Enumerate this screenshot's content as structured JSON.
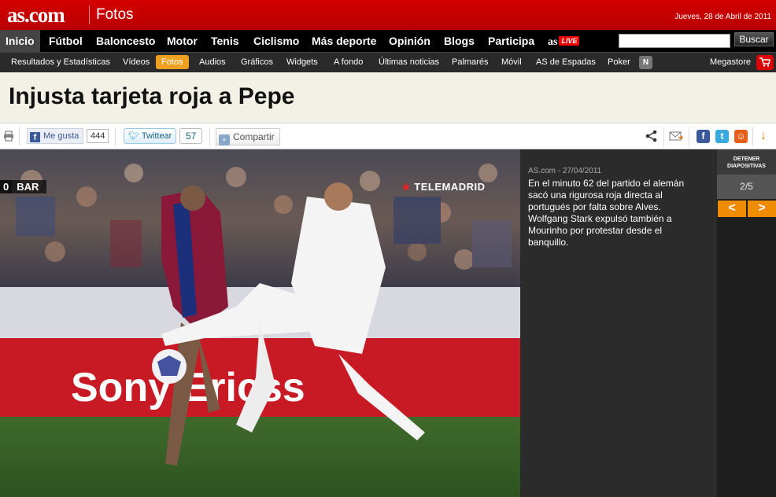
{
  "header": {
    "logo": "as.com",
    "section": "Fotos",
    "date": "Jueves, 28 de Abril de 2011"
  },
  "main_nav": {
    "items": [
      "Inicio",
      "Fútbol",
      "Baloncesto",
      "Motor",
      "Tenis",
      "Ciclismo",
      "Más deporte",
      "Opinión",
      "Blogs",
      "Participa"
    ],
    "active": "Inicio",
    "aslive_brand": "as",
    "aslive_badge": "LIVE",
    "search_value": "",
    "search_button": "Buscar"
  },
  "sub_nav": {
    "items": [
      "Resultados y Estadísticas",
      "Vídeos",
      "Fotos",
      "Audios",
      "Gráficos",
      "Widgets",
      "A fondo",
      "Últimas noticias",
      "Palmarés",
      "Móvil",
      "AS de Espadas",
      "Poker"
    ],
    "active": "Fotos",
    "badge": "N",
    "megastore": "Megastore"
  },
  "page_title": "Injusta tarjeta roja a Pepe",
  "share_bar": {
    "like_label": "Me gusta",
    "like_count": "444",
    "tweet_label": "Twittear",
    "tweet_count": "57",
    "share_label": "Compartir"
  },
  "photo": {
    "score_number": "0",
    "score_team": "BAR",
    "watermark": "TELEMADRID",
    "board_text": "Sony Ericss"
  },
  "caption": {
    "meta": "AS.com - 27/04/2011",
    "text": "En el minuto 62 del partido el alemán sacó una rigurosa roja directa al portugués por falta sobre Alves. Wolfgang Stark expulsó también a Mourinho por protestar desde el banquillo."
  },
  "slideshow": {
    "stop_label_1": "DETENER",
    "stop_label_2": "DIAPOSITIVAS",
    "position": "2/5",
    "prev": "<",
    "next": ">"
  },
  "colors": {
    "brand_red": "#c80000",
    "accent_orange": "#f08c00"
  }
}
